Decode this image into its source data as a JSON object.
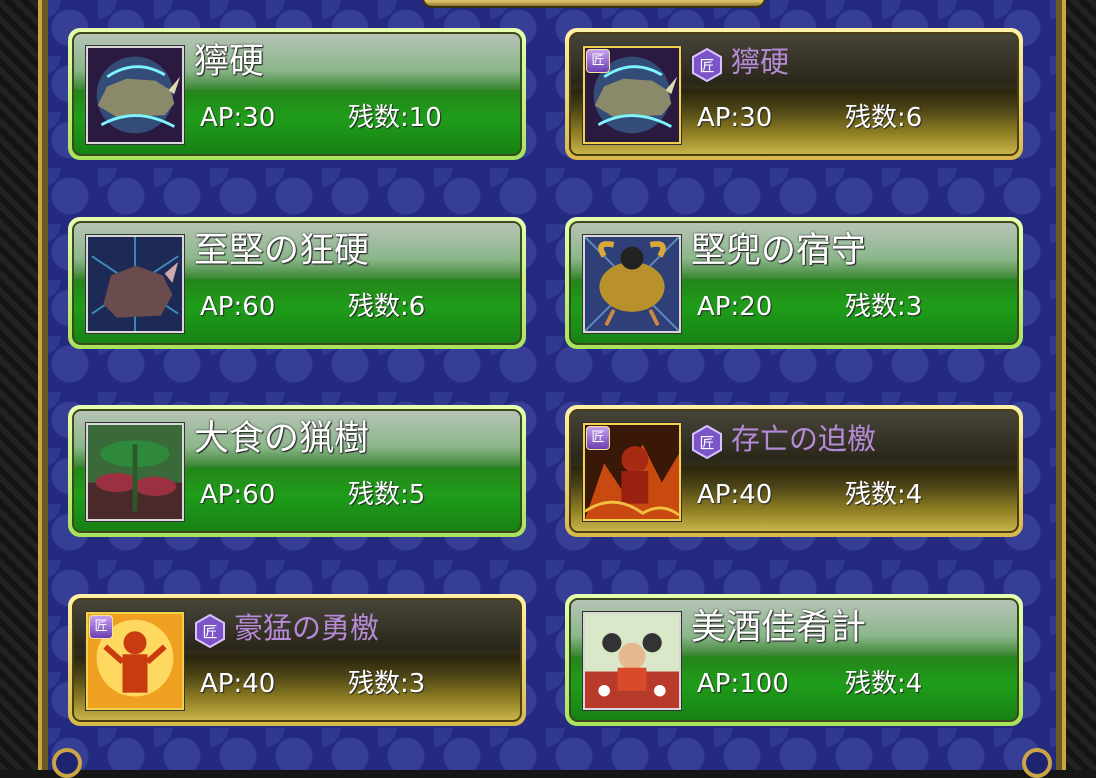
{
  "badge_text": "匠",
  "labels": {
    "ap": "AP:",
    "remaining": "残数:"
  },
  "cards": [
    {
      "name": "獰硬",
      "ap": "30",
      "remaining": "10",
      "style": "green",
      "special": false,
      "art": "rhino"
    },
    {
      "name": "獰硬",
      "ap": "30",
      "remaining": "6",
      "style": "gold",
      "special": true,
      "art": "rhino"
    },
    {
      "name": "至堅の狂硬",
      "ap": "60",
      "remaining": "6",
      "style": "green",
      "special": false,
      "art": "dark-rhino"
    },
    {
      "name": "堅兜の宿守",
      "ap": "20",
      "remaining": "3",
      "style": "green",
      "special": false,
      "art": "beetle"
    },
    {
      "name": "大食の猟樹",
      "ap": "60",
      "remaining": "5",
      "style": "green",
      "special": false,
      "art": "plant"
    },
    {
      "name": "存亡の迫檄",
      "ap": "40",
      "remaining": "4",
      "style": "gold",
      "special": true,
      "art": "fire-warrior"
    },
    {
      "name": "豪猛の勇檄",
      "ap": "40",
      "remaining": "3",
      "style": "gold",
      "special": true,
      "art": "flame-hero"
    },
    {
      "name": "美酒佳肴計",
      "ap": "100",
      "remaining": "4",
      "style": "green",
      "special": false,
      "art": "feast"
    }
  ]
}
